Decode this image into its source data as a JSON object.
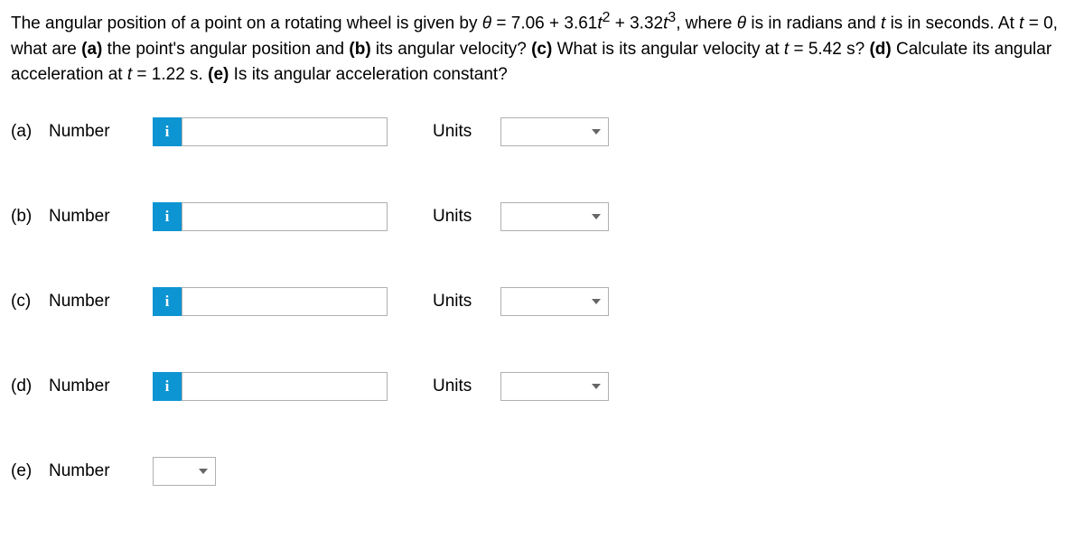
{
  "question": {
    "prefix": "The angular position of a point on a rotating wheel is given by ",
    "theta": "θ",
    "eq": " = 7.06 + 3.61",
    "t": "t",
    "sup2": "2",
    "plus": " + 3.32",
    "sup3": "3",
    "where_pre": ", where ",
    "is_rad": " is in radians and ",
    "is_sec": " is in seconds. At ",
    "teq0": " = 0, what are ",
    "a_bold": "(a)",
    "a_text": " the point's angular position and ",
    "b_bold": "(b)",
    "b_text": " its angular velocity? ",
    "c_bold": "(c)",
    "c_text": " What is its angular velocity at ",
    "c_time": " = 5.42 s? ",
    "d_bold": "(d)",
    "d_text": " Calculate its angular acceleration at ",
    "d_time": " = 1.22 s. ",
    "e_bold": "(e)",
    "e_text": " Is its angular acceleration constant?"
  },
  "labels": {
    "number": "Number",
    "units": "Units",
    "info": "i"
  },
  "parts": {
    "a": "(a)",
    "b": "(b)",
    "c": "(c)",
    "d": "(d)",
    "e": "(e)"
  },
  "inputs": {
    "a_value": "",
    "b_value": "",
    "c_value": "",
    "d_value": "",
    "a_units": "",
    "b_units": "",
    "c_units": "",
    "d_units": "",
    "e_value": ""
  }
}
